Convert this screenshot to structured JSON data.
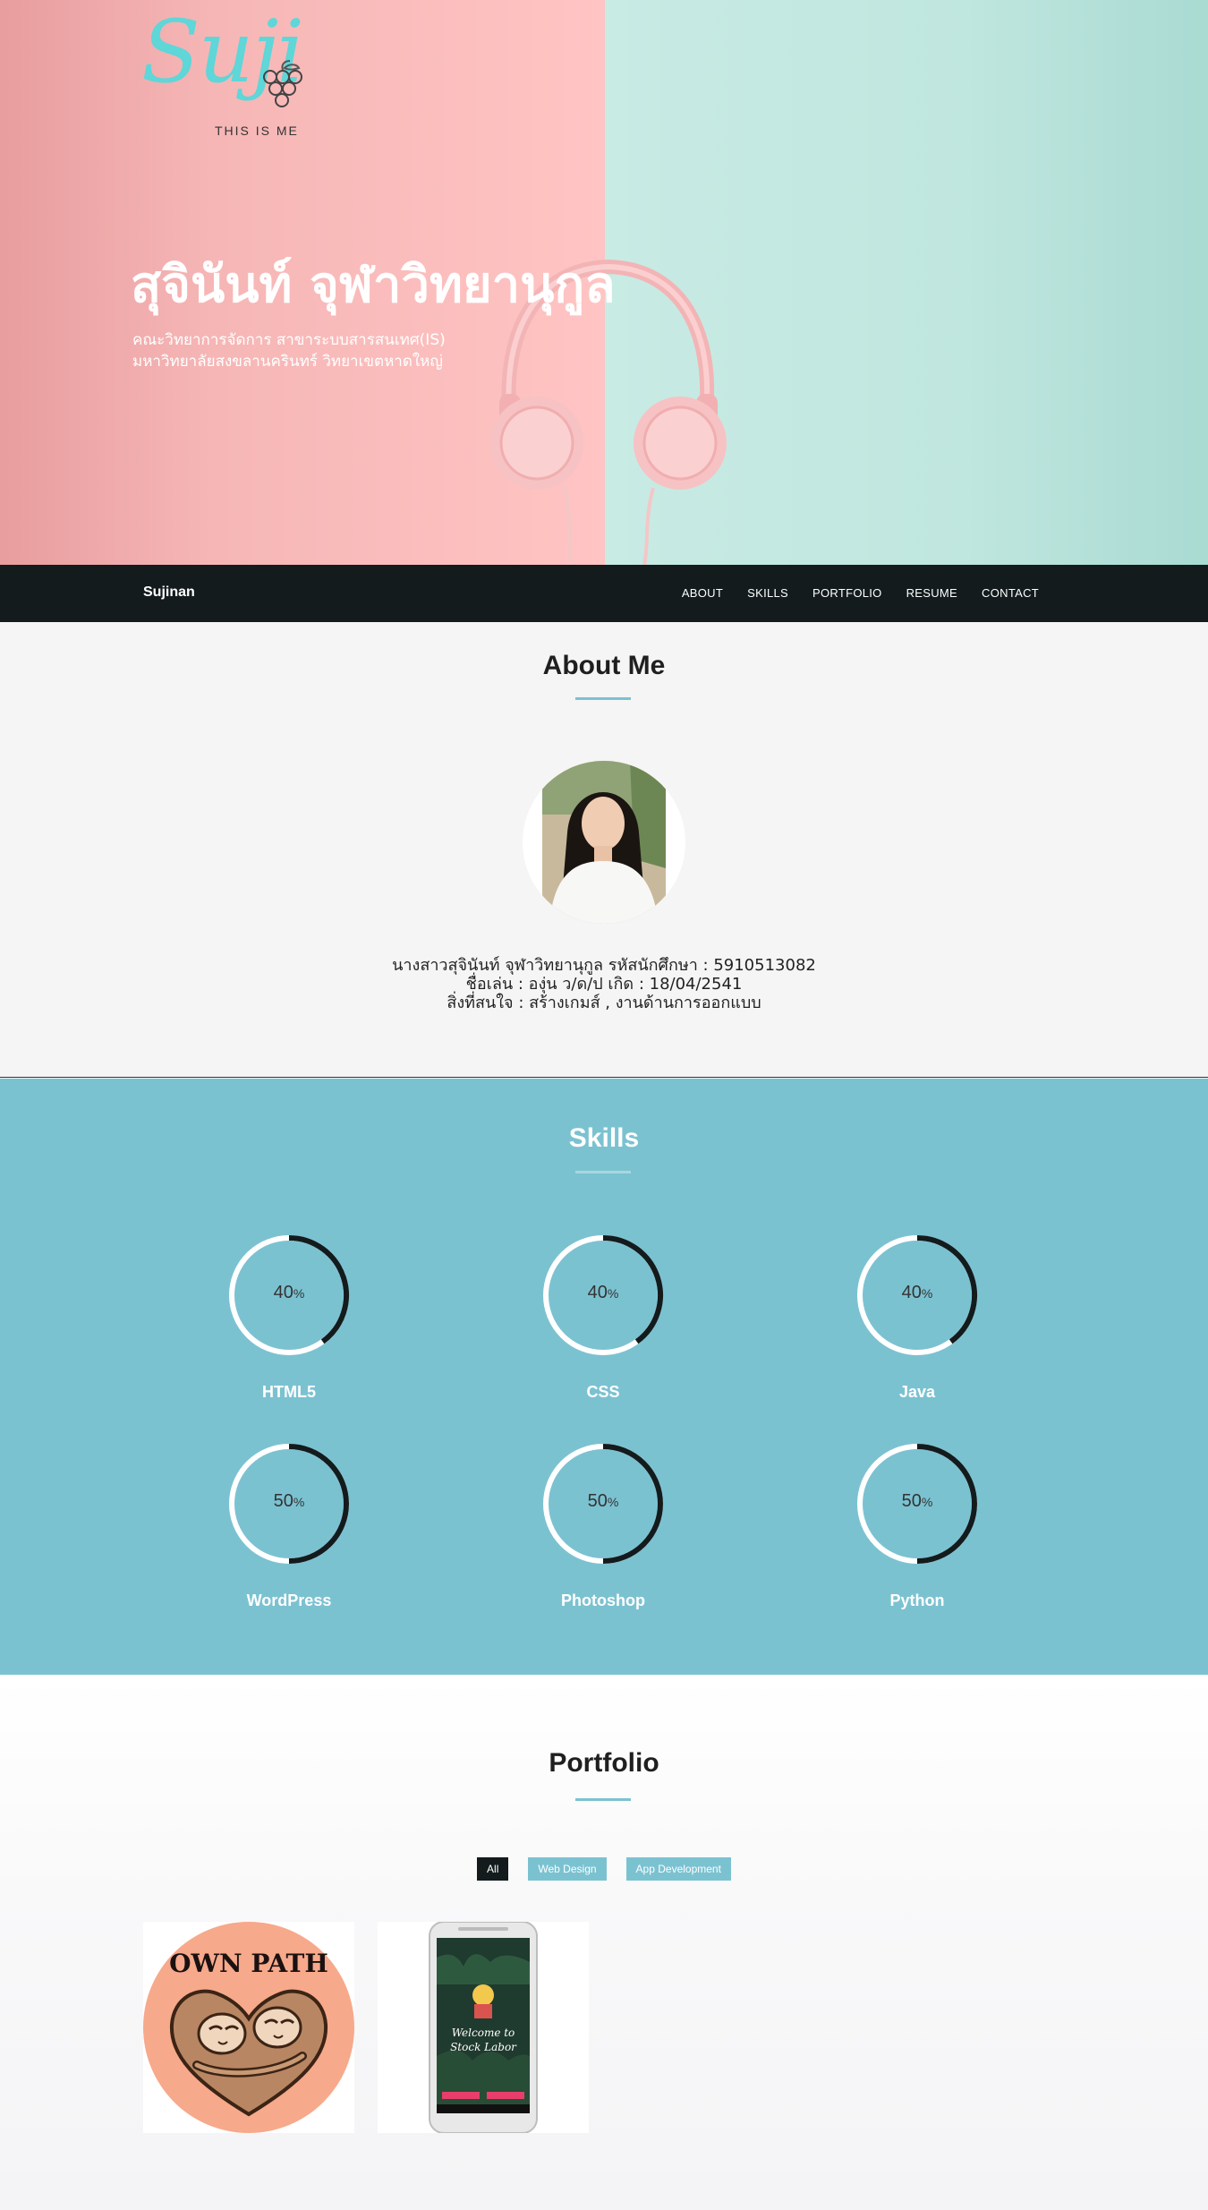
{
  "hero": {
    "logo_script": "Suji",
    "logo_tagline": "THIS IS ME",
    "name": "สุจินันท์ จุฬาวิทยานุกูล",
    "line1": "คณะวิทยาการจัดการ สาขาระบบสารสนเทศ(IS)",
    "line2": "มหาวิทยาลัยสงขลานครินทร์ วิทยาเขตหาดใหญ่"
  },
  "navbar": {
    "brand": "Sujinan",
    "links": [
      "ABOUT",
      "SKILLS",
      "PORTFOLIO",
      "RESUME",
      "CONTACT"
    ]
  },
  "about": {
    "title": "About Me",
    "line1": "นางสาวสุจินันท์ จุฬาวิทยานุกูล รหัสนักศึกษา : 5910513082",
    "line2": "ชื่อเล่น : องุ่น   ว/ด/ป เกิด : 18/04/2541",
    "line3": "สิ่งที่สนใจ : สร้างเกมส์ , งานด้านการออกแบบ"
  },
  "skills": {
    "title": "Skills",
    "items": [
      {
        "label": "HTML5",
        "percent": 40,
        "pct_text": "40"
      },
      {
        "label": "CSS",
        "percent": 40,
        "pct_text": "40"
      },
      {
        "label": "Java",
        "percent": 40,
        "pct_text": "40"
      },
      {
        "label": "WordPress",
        "percent": 50,
        "pct_text": "50"
      },
      {
        "label": "Photoshop",
        "percent": 50,
        "pct_text": "50"
      },
      {
        "label": "Python",
        "percent": 50,
        "pct_text": "50"
      }
    ],
    "pct_sign": "%"
  },
  "portfolio": {
    "title": "Portfolio",
    "filters": [
      "All",
      "Web Design",
      "App Development"
    ],
    "card1_text": "OWN PATH",
    "card2_line1": "Welcome to",
    "card2_line2": "Stock Labor"
  },
  "colors": {
    "accent": "#7bc2d1",
    "dark": "#131b1d",
    "hero_pink": "#ffc4c3",
    "hero_mint": "#bfe6df"
  }
}
